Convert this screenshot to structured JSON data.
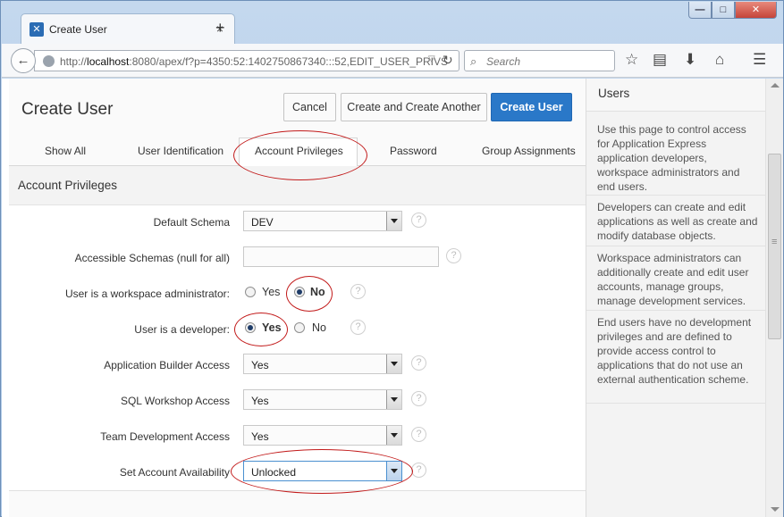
{
  "browser": {
    "tab_title": "Create User",
    "tab_close": "×",
    "new_tab": "+",
    "url_prefix": "http://",
    "url_host": "localhost",
    "url_rest": ":8080/apex/f?p=4350:52:1402750867340:::52,EDIT_USER_PRIVS",
    "search_placeholder": "Search",
    "icons": [
      "back-arrow-icon",
      "globe-icon",
      "reload-icon",
      "star-icon",
      "reading-list-icon",
      "download-icon",
      "home-icon",
      "menu-icon"
    ]
  },
  "page": {
    "title": "Create User",
    "buttons": {
      "cancel": "Cancel",
      "create_another": "Create and Create Another",
      "create": "Create User"
    },
    "tabs": [
      "Show All",
      "User Identification",
      "Account Privileges",
      "Password",
      "Group Assignments"
    ],
    "active_tab": "Account Privileges",
    "region_title": "Account Privileges",
    "form": {
      "default_schema": {
        "label": "Default Schema",
        "value": "DEV"
      },
      "accessible_schemas": {
        "label": "Accessible Schemas (null for all)",
        "value": ""
      },
      "workspace_admin": {
        "label": "User is a workspace administrator:",
        "yes": "Yes",
        "no": "No",
        "selected": "No"
      },
      "developer": {
        "label": "User is a developer:",
        "yes": "Yes",
        "no": "No",
        "selected": "Yes"
      },
      "app_builder": {
        "label": "Application Builder Access",
        "value": "Yes"
      },
      "sql_workshop": {
        "label": "SQL Workshop Access",
        "value": "Yes"
      },
      "team_dev": {
        "label": "Team Development Access",
        "value": "Yes"
      },
      "availability": {
        "label": "Set Account Availability",
        "value": "Unlocked"
      }
    },
    "help_glyph": "?"
  },
  "side_panel": {
    "title": "Users",
    "paragraphs": [
      "Use this page to control access for Application Express application developers, workspace administrators and end users.",
      "Developers can create and edit applications as well as create and modify database objects.",
      "Workspace administrators can additionally create and edit user accounts, manage groups, manage development services.",
      "End users have no development privileges and are defined to provide access control to applications that do not use an external authentication scheme."
    ]
  },
  "colors": {
    "primary_button": "#2a78c8",
    "annotation_oval": "#c21a1a"
  }
}
